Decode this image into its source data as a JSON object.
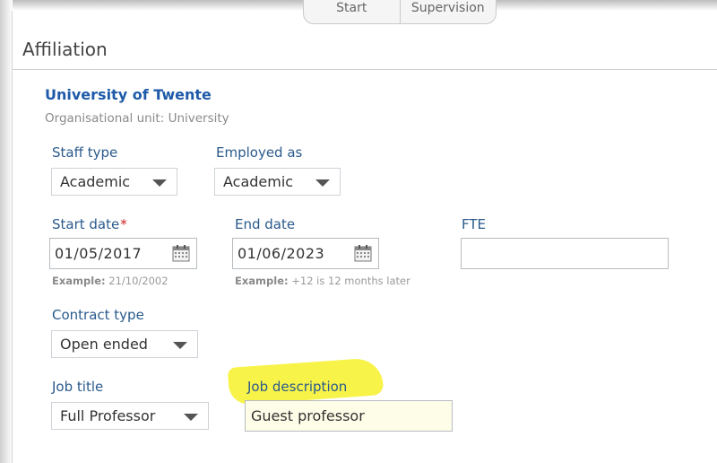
{
  "top_tabs": [
    "Start",
    "Supervision"
  ],
  "panel": {
    "title": "Affiliation"
  },
  "organisation": {
    "name": "University of Twente",
    "unit": "Organisational unit: University"
  },
  "fields": {
    "staff_type": {
      "label": "Staff type",
      "value": "Academic"
    },
    "employed_as": {
      "label": "Employed as",
      "value": "Academic"
    },
    "start_date": {
      "label": "Start date",
      "required_marker": "*",
      "value": "01/05/2017",
      "hint_prefix": "Example:",
      "hint_value": "21/10/2002"
    },
    "end_date": {
      "label": "End date",
      "value": "01/06/2023",
      "hint_prefix": "Example:",
      "hint_value": "+12 is 12 months later"
    },
    "fte": {
      "label": "FTE",
      "value": ""
    },
    "contract_type": {
      "label": "Contract type",
      "value": "Open ended"
    },
    "job_title": {
      "label": "Job title",
      "value": "Full Professor"
    },
    "job_description": {
      "label": "Job description",
      "value": "Guest professor"
    }
  },
  "colors": {
    "label": "#2a5a8c",
    "org_name": "#1e5aa8",
    "required": "#cc2222",
    "highlight": "#f7f23a",
    "job_description_bg": "#fefde8"
  }
}
